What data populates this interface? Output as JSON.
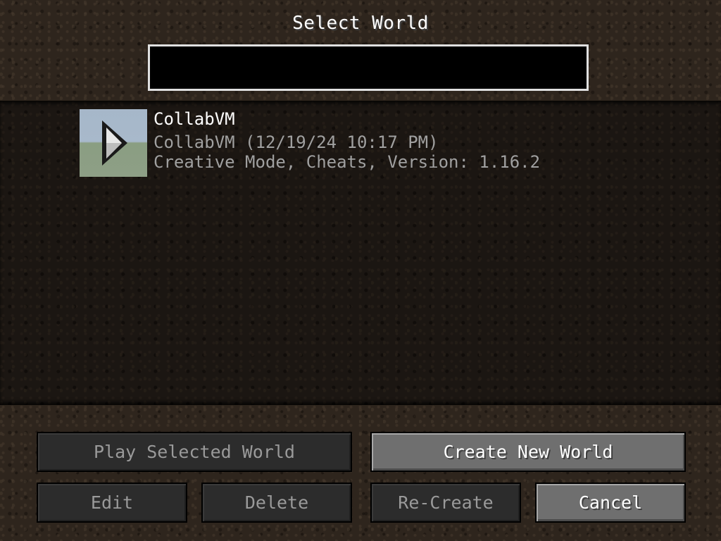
{
  "screen": {
    "title": "Select World"
  },
  "search": {
    "value": "",
    "placeholder": ""
  },
  "worlds": [
    {
      "name": "CollabVM",
      "file": "CollabVM (12/19/24 10:17 PM)",
      "info": "Creative Mode, Cheats, Version: 1.16.2",
      "icon": "play-arrow-icon"
    }
  ],
  "buttons": {
    "play_selected": "Play Selected World",
    "create_new": "Create New World",
    "edit": "Edit",
    "delete": "Delete",
    "recreate": "Re-Create",
    "cancel": "Cancel"
  },
  "colors": {
    "background": "#2e251d",
    "list_background": "#1b1612",
    "text_primary": "#ffffff",
    "text_secondary": "#a0a0a0",
    "button_enabled": "#6f6f6f",
    "button_disabled": "#2c2c2c"
  }
}
